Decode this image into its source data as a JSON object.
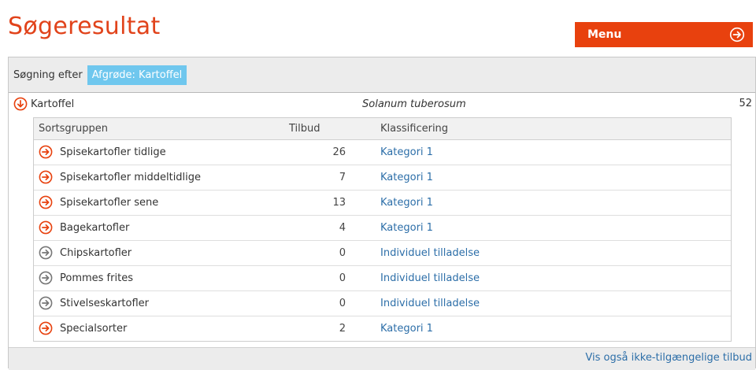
{
  "page": {
    "title": "Søgeresultat"
  },
  "menu": {
    "label": "Menu",
    "icon": "arrow-right-circle-icon"
  },
  "search": {
    "label": "Søgning efter",
    "tag": "Afgrøde: Kartoffel"
  },
  "crop": {
    "name": "Kartoffel",
    "latin": "Solanum tuberosum",
    "count": "52",
    "icon": "arrow-down-circle-icon"
  },
  "table": {
    "headers": {
      "group": "Sortsgruppen",
      "offers": "Tilbud",
      "classification": "Klassificering"
    },
    "rows": [
      {
        "name": "Spisekartofler tidlige",
        "offers": "26",
        "classification": "Kategori 1",
        "active": true
      },
      {
        "name": "Spisekartofler middeltidlige",
        "offers": "7",
        "classification": "Kategori 1",
        "active": true
      },
      {
        "name": "Spisekartofler sene",
        "offers": "13",
        "classification": "Kategori 1",
        "active": true
      },
      {
        "name": "Bagekartofler",
        "offers": "4",
        "classification": "Kategori 1",
        "active": true
      },
      {
        "name": "Chipskartofler",
        "offers": "0",
        "classification": "Individuel tilladelse",
        "active": false
      },
      {
        "name": "Pommes frites",
        "offers": "0",
        "classification": "Individuel tilladelse",
        "active": false
      },
      {
        "name": "Stivelseskartofler",
        "offers": "0",
        "classification": "Individuel tilladelse",
        "active": false
      },
      {
        "name": "Specialsorter",
        "offers": "2",
        "classification": "Kategori 1",
        "active": true
      }
    ]
  },
  "footer": {
    "link": "Vis også ikke-tilgængelige tilbud"
  },
  "colors": {
    "accent": "#e8410e",
    "title": "#e1431b",
    "tag": "#6fc7ee",
    "link": "#2c6ea8",
    "inactive_icon": "#777777"
  }
}
